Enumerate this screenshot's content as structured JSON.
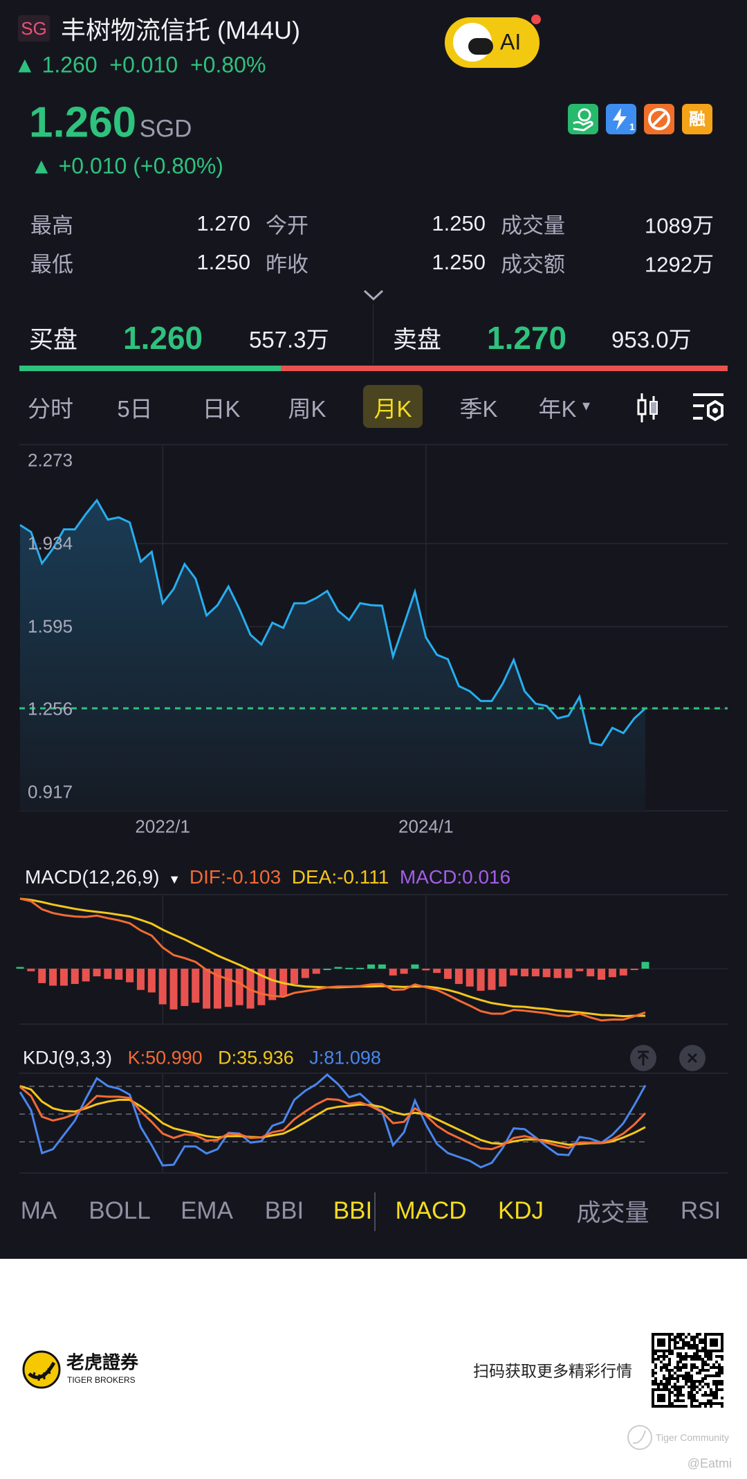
{
  "header": {
    "market_badge": "SG",
    "title": "丰树物流信托 (M44U)",
    "summary_price": "1.260",
    "summary_change": "+0.010",
    "summary_pct": "+0.80%",
    "ai_label": "AI"
  },
  "quote": {
    "price": "1.260",
    "currency": "SGD",
    "change_line": "+0.010 (+0.80%)",
    "badges": [
      {
        "icon": "cash-hand-icon",
        "color": "#27b96c"
      },
      {
        "icon": "lightning-1-icon",
        "label": "1",
        "color": "#3d8ef0"
      },
      {
        "icon": "no-short-icon",
        "color": "#f0702a"
      },
      {
        "icon": "margin-icon",
        "label": "融",
        "color": "#f5a318"
      }
    ]
  },
  "stats": [
    [
      {
        "label": "最高",
        "value": "1.270"
      },
      {
        "label": "今开",
        "value": "1.250"
      },
      {
        "label": "成交量",
        "value": "1089万"
      }
    ],
    [
      {
        "label": "最低",
        "value": "1.250"
      },
      {
        "label": "昨收",
        "value": "1.250"
      },
      {
        "label": "成交额",
        "value": "1292万"
      }
    ]
  ],
  "orderbook": {
    "bid_label": "买盘",
    "bid_price": "1.260",
    "bid_size": "557.3万",
    "ask_label": "卖盘",
    "ask_price": "1.270",
    "ask_size": "953.0万",
    "bid_ratio": 0.369
  },
  "period_tabs": [
    "分时",
    "5日",
    "日K",
    "周K",
    "月K",
    "季K",
    "年K"
  ],
  "active_period": "月K",
  "colors": {
    "up": "#2ec27e",
    "down": "#e9534f",
    "price_line": "#27aef0",
    "dif": "#f26b34",
    "dea": "#f5c71a",
    "j": "#4a86ee",
    "macd_label": "#a45ee8",
    "accent": "#f5dd1e"
  },
  "chart_data": [
    {
      "type": "area",
      "y_tick_labels": [
        "2.273",
        "1.934",
        "1.595",
        "1.256",
        "0.917"
      ],
      "ylim": [
        0.917,
        2.273
      ],
      "x_tick_labels": [
        "2022/1",
        "2024/1"
      ],
      "x_tick_index": [
        13,
        37
      ],
      "current_price_line": 1.26,
      "grid": true,
      "values": [
        2.01,
        1.981,
        1.853,
        1.913,
        1.992,
        1.992,
        2.055,
        2.111,
        2.032,
        2.041,
        2.02,
        1.86,
        1.9,
        1.69,
        1.748,
        1.85,
        1.79,
        1.64,
        1.682,
        1.758,
        1.666,
        1.561,
        1.521,
        1.61,
        1.589,
        1.69,
        1.69,
        1.711,
        1.74,
        1.659,
        1.621,
        1.69,
        1.682,
        1.68,
        1.472,
        1.603,
        1.737,
        1.55,
        1.479,
        1.461,
        1.351,
        1.33,
        1.29,
        1.29,
        1.361,
        1.458,
        1.33,
        1.279,
        1.27,
        1.219,
        1.23,
        1.307,
        1.119,
        1.109,
        1.18,
        1.159,
        1.219,
        1.26
      ]
    },
    {
      "type": "line",
      "title": "MACD(12,26,9)",
      "legend": {
        "dif": "DIF:-0.103",
        "dea": "DEA:-0.111",
        "macd": "MACD:0.016"
      },
      "dif": [
        0.165,
        0.159,
        0.14,
        0.131,
        0.126,
        0.123,
        0.122,
        0.125,
        0.119,
        0.114,
        0.107,
        0.09,
        0.078,
        0.05,
        0.032,
        0.025,
        0.016,
        -0.003,
        -0.016,
        -0.025,
        -0.034,
        -0.05,
        -0.059,
        -0.064,
        -0.066,
        -0.057,
        -0.053,
        -0.049,
        -0.044,
        -0.042,
        -0.042,
        -0.041,
        -0.037,
        -0.036,
        -0.05,
        -0.049,
        -0.037,
        -0.044,
        -0.05,
        -0.062,
        -0.075,
        -0.087,
        -0.1,
        -0.106,
        -0.106,
        -0.097,
        -0.099,
        -0.102,
        -0.105,
        -0.11,
        -0.112,
        -0.106,
        -0.115,
        -0.122,
        -0.12,
        -0.12,
        -0.112,
        -0.103
      ],
      "dea": [
        0.165,
        0.162,
        0.157,
        0.151,
        0.146,
        0.141,
        0.137,
        0.134,
        0.131,
        0.127,
        0.123,
        0.115,
        0.106,
        0.092,
        0.08,
        0.069,
        0.056,
        0.044,
        0.031,
        0.02,
        0.009,
        -0.003,
        -0.016,
        -0.027,
        -0.034,
        -0.039,
        -0.042,
        -0.043,
        -0.044,
        -0.044,
        -0.043,
        -0.042,
        -0.042,
        -0.041,
        -0.042,
        -0.043,
        -0.042,
        -0.042,
        -0.045,
        -0.05,
        -0.057,
        -0.066,
        -0.074,
        -0.081,
        -0.085,
        -0.089,
        -0.09,
        -0.093,
        -0.095,
        -0.099,
        -0.101,
        -0.103,
        -0.106,
        -0.109,
        -0.11,
        -0.112,
        -0.111,
        -0.111
      ],
      "macd": [
        0.004,
        -0.006,
        -0.034,
        -0.04,
        -0.04,
        -0.036,
        -0.03,
        -0.018,
        -0.024,
        -0.026,
        -0.032,
        -0.05,
        -0.056,
        -0.084,
        -0.096,
        -0.088,
        -0.08,
        -0.094,
        -0.094,
        -0.09,
        -0.086,
        -0.094,
        -0.086,
        -0.074,
        -0.064,
        -0.036,
        -0.022,
        -0.012,
        0.0,
        0.004,
        0.002,
        0.002,
        0.01,
        0.01,
        -0.016,
        -0.012,
        0.01,
        -0.004,
        -0.01,
        -0.024,
        -0.036,
        -0.042,
        -0.052,
        -0.05,
        -0.042,
        -0.016,
        -0.018,
        -0.018,
        -0.02,
        -0.022,
        -0.022,
        -0.006,
        -0.018,
        -0.026,
        -0.02,
        -0.016,
        -0.002,
        0.016
      ]
    },
    {
      "type": "line",
      "title": "KDJ(9,3,3)",
      "legend": {
        "k": "K:50.990",
        "d": "D:35.936",
        "j": "J:81.098"
      },
      "reference_lines": [
        80,
        50,
        20
      ],
      "k": [
        79.4,
        69.6,
        47.2,
        43.0,
        45.8,
        50.0,
        58.4,
        69.6,
        68.8,
        68.8,
        67.4,
        52.8,
        41.6,
        29.0,
        24.2,
        28.1,
        27.0,
        21.4,
        22.0,
        29.0,
        28.1,
        24.2,
        24.8,
        30.4,
        32.6,
        44.4,
        52.8,
        60.4,
        66.3,
        65.4,
        61.2,
        62.6,
        58.4,
        52.2,
        40.2,
        41.6,
        56.2,
        48.6,
        37.4,
        29.8,
        24.2,
        18.6,
        13.0,
        12.1,
        16.4,
        24.2,
        26.2,
        23.4,
        19.2,
        15.8,
        13.5,
        19.2,
        19.2,
        18.6,
        22.5,
        29.0,
        38.8,
        50.99
      ],
      "d": [
        80.3,
        76.6,
        63.5,
        56.2,
        53.4,
        52.8,
        56.2,
        60.7,
        63.5,
        65.4,
        65.4,
        58.4,
        50.0,
        40.2,
        34.6,
        31.8,
        29.0,
        26.2,
        24.8,
        26.2,
        26.2,
        25.3,
        24.8,
        27.0,
        29.0,
        34.6,
        41.6,
        48.6,
        55.6,
        57.9,
        59.0,
        60.4,
        59.8,
        57.6,
        52.2,
        49.4,
        51.4,
        50.0,
        44.4,
        38.8,
        33.2,
        27.6,
        22.0,
        18.6,
        17.8,
        20.6,
        22.5,
        22.5,
        21.4,
        19.2,
        16.9,
        17.8,
        18.6,
        18.6,
        20.6,
        24.8,
        29.8,
        35.936
      ],
      "j": [
        73.8,
        54.2,
        7.9,
        12.1,
        27.6,
        43.0,
        66.8,
        88.7,
        80.3,
        77.5,
        71.0,
        36.0,
        16.4,
        -5.5,
        -4.7,
        15.0,
        15.0,
        7.4,
        12.1,
        29.8,
        29.0,
        19.2,
        20.6,
        37.4,
        41.6,
        65.4,
        75.2,
        82.2,
        92.6,
        82.2,
        68.2,
        71.9,
        61.2,
        52.8,
        16.4,
        30.4,
        64.6,
        38.8,
        17.8,
        7.9,
        3.7,
        -0.5,
        -7.5,
        -2.7,
        13.5,
        34.6,
        33.7,
        24.8,
        15.0,
        6.5,
        5.7,
        25.3,
        23.4,
        19.2,
        27.6,
        40.2,
        59.8,
        81.098
      ]
    }
  ],
  "indicator_tabs": [
    {
      "label": "MA",
      "active": false
    },
    {
      "label": "BOLL",
      "active": false
    },
    {
      "label": "EMA",
      "active": false
    },
    {
      "label": "BBI",
      "active": false
    },
    {
      "label": "BBI",
      "active": true
    },
    {
      "label": "MACD",
      "active": true
    },
    {
      "label": "KDJ",
      "active": true
    },
    {
      "label": "成交量",
      "active": false
    },
    {
      "label": "RSI",
      "active": false
    }
  ],
  "footer": {
    "brand_cn": "老虎證券",
    "brand_en": "TIGER BROKERS",
    "qr_caption": "扫码获取更多精彩行情",
    "watermark": "Tiger Community",
    "user": "@Eatmi"
  }
}
